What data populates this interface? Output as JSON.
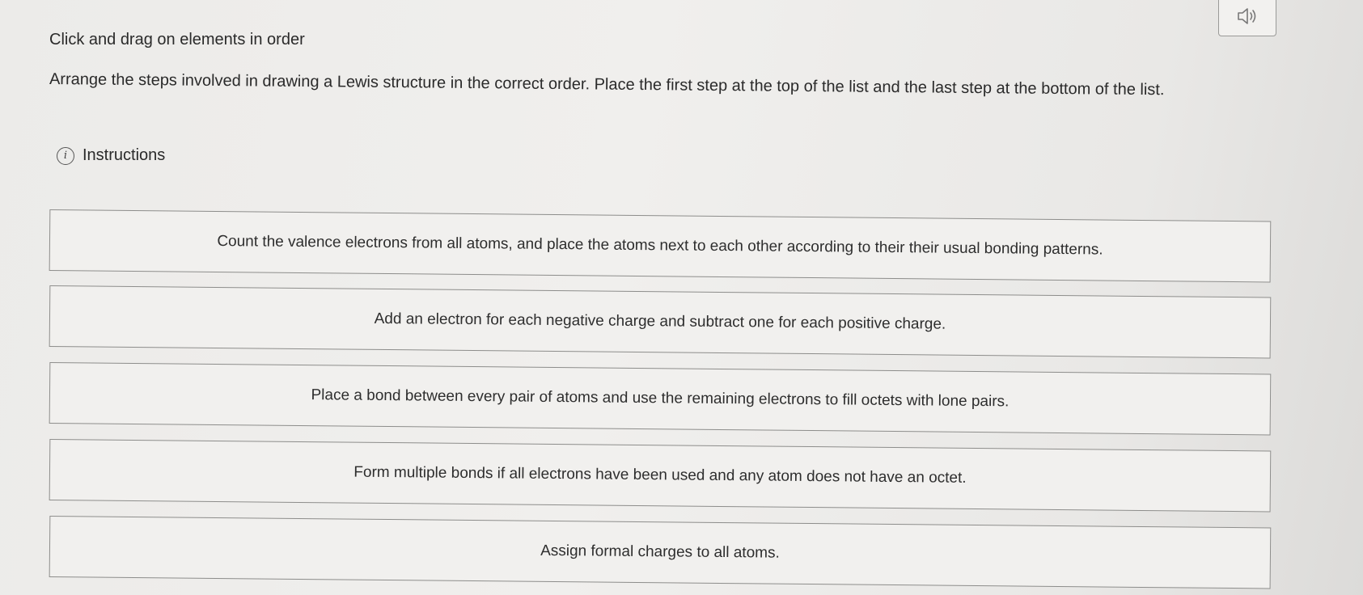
{
  "header": {
    "prompt": "Click and drag on elements in order",
    "question": "Arrange the steps involved in drawing a Lewis structure in the correct order. Place the first step at the top of the list and the last step at the bottom of the list.",
    "instructions_label": "Instructions",
    "audio_icon": "speaker-icon",
    "info_icon": "info-icon"
  },
  "steps": [
    "Count the valence electrons from all atoms, and place the atoms next to each other according to their their usual bonding patterns.",
    "Add an electron for each negative charge and subtract one for each positive charge.",
    "Place a bond between every pair of atoms and use the remaining electrons to fill octets with lone pairs.",
    "Form multiple bonds if all electrons have been used and any atom does not have an octet.",
    "Assign formal charges to all atoms."
  ]
}
